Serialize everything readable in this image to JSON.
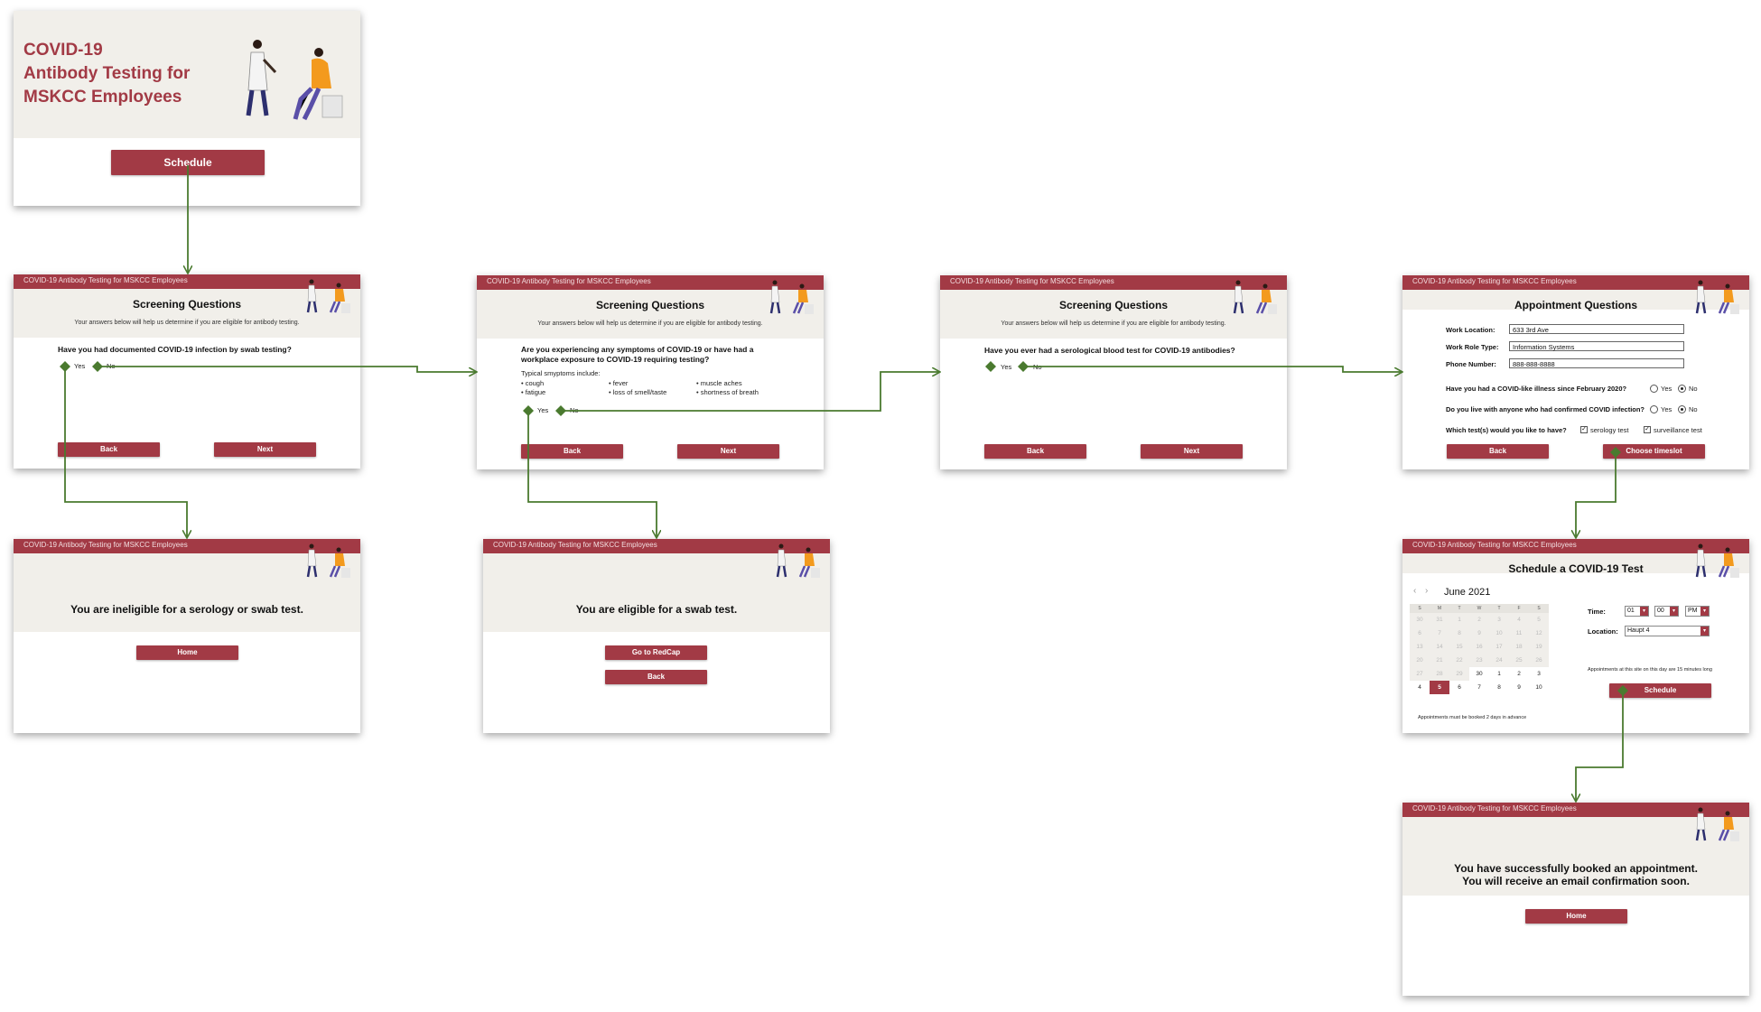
{
  "banner": "COVID-19 Antibody Testing for MSKCC Employees",
  "landing": {
    "title_lines": [
      "COVID-19",
      "Antibody Testing for",
      "MSKCC Employees"
    ],
    "schedule_button": "Schedule"
  },
  "screening": {
    "title": "Screening Questions",
    "subtitle": "Your answers below will help us determine if you are eligible for antibody testing.",
    "back": "Back",
    "next": "Next",
    "yes": "Yes",
    "no": "No",
    "q1": "Have you had documented COVID-19 infection by swab testing?",
    "q2": "Are you experiencing any symptoms of COVID-19 or have had a workplace exposure to COVID-19 requiring testing?",
    "q2_symptoms_label": "Typical smyptoms include:",
    "q2_symptoms": [
      "• cough",
      "• fever",
      "• muscle aches",
      "• fatigue",
      "• loss of smell/taste",
      "• shortness of breath"
    ],
    "q3": "Have you ever had a serological blood test for COVID-19 antibodies?"
  },
  "appointment": {
    "title": "Appointment Questions",
    "work_location_label": "Work Location:",
    "work_location_value": "633 3rd Ave",
    "work_role_label": "Work Role Type:",
    "work_role_value": "Information Systems",
    "phone_label": "Phone Number:",
    "phone_value": "888-888-8888",
    "q_illness": "Have you had a COVID-like illness since February 2020?",
    "q_live": "Do you live with anyone who had confirmed COVID infection?",
    "q_tests": "Which test(s) would you like to have?",
    "test1": "serology test",
    "test2": "surveillance test",
    "yes": "Yes",
    "no": "No",
    "back": "Back",
    "choose": "Choose timeslot"
  },
  "ineligible": {
    "message": "You are ineligible for a serology or swab test.",
    "home": "Home"
  },
  "eligible": {
    "message": "You are eligible for a swab test.",
    "redcap": "Go to RedCap",
    "back": "Back"
  },
  "schedule": {
    "title": "Schedule a COVID-19 Test",
    "month": "June 2021",
    "weekdays": [
      "S",
      "M",
      "T",
      "W",
      "T",
      "F",
      "S"
    ],
    "time_label": "Time:",
    "hour": "01",
    "minute": "00",
    "ampm": "PM",
    "location_label": "Location:",
    "location_value": "Haupt 4",
    "duration_note": "Appointments at this site on this day are 15 minutes long",
    "advance_note": "Appointments must be booked 2 days in advance",
    "schedule_button": "Schedule"
  },
  "confirmation": {
    "line1": "You have successfully booked an appointment.",
    "line2": "You will receive an email confirmation soon.",
    "home": "Home"
  },
  "colors": {
    "brand": "#a23a45",
    "band": "#f1efea",
    "flow_arrow": "#4a7a2f"
  }
}
